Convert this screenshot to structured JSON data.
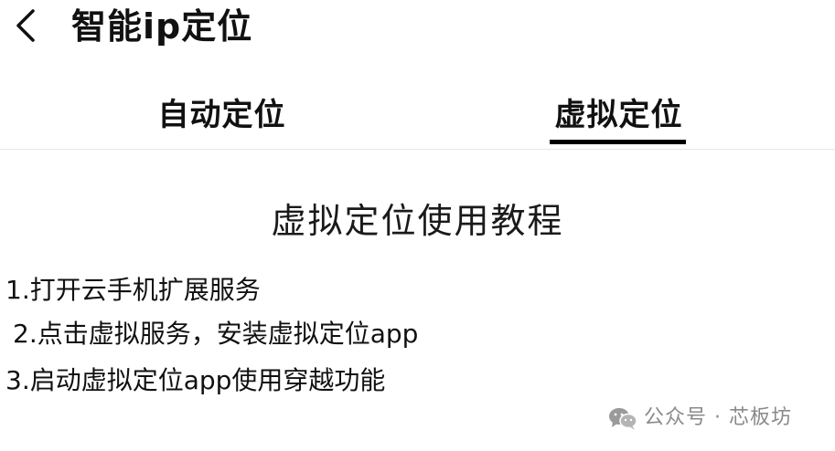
{
  "header": {
    "title": "智能ip定位",
    "back_icon": "chevron-left-icon"
  },
  "tabs": [
    {
      "label": "自动定位",
      "active": false
    },
    {
      "label": "虚拟定位",
      "active": true
    }
  ],
  "tutorial": {
    "title": "虚拟定位使用教程",
    "steps": [
      "1.打开云手机扩展服务",
      "2.点击虚拟服务，安装虚拟定位app",
      "3.启动虚拟定位app使用穿越功能"
    ]
  },
  "watermark": {
    "icon": "wechat-icon",
    "text": "公众号 · 芯板坊"
  },
  "colors": {
    "background": "#ffffff",
    "text": "#111111",
    "indicator": "#000000",
    "divider": "#e6e6e6",
    "watermark": "#8a8a8a"
  }
}
